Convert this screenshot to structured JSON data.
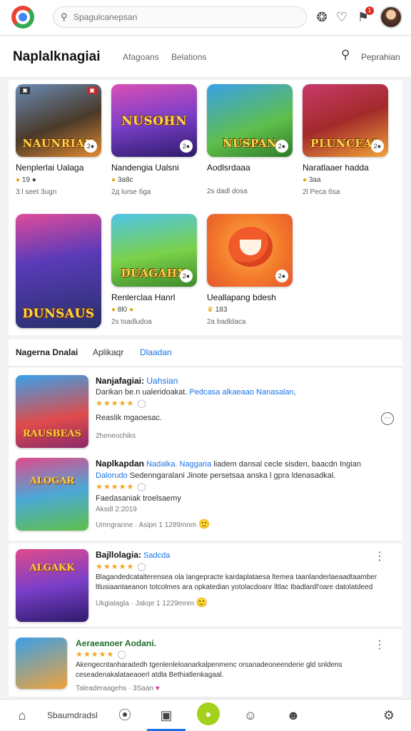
{
  "topbar": {
    "search_placeholder": "Spagulcanepsan",
    "notification_count": "1"
  },
  "header": {
    "title": "Naplalknagiai",
    "tabs": [
      "Afagoans",
      "Belations"
    ],
    "right_link": "Peprahian"
  },
  "grid": [
    {
      "name": "Nenplerlai Ualaga",
      "rating": "19 ●",
      "meta": "3:l seet 3ugn",
      "art": "NAUNRIAN"
    },
    {
      "name": "Nandengia Ualsni",
      "rating": "3a8с",
      "meta": "2д lurse бga",
      "art": "NUSOHN"
    },
    {
      "name": "Aodlsrdaaa",
      "rating": "",
      "meta": "2s dadl dosa",
      "art": "NUSPAN"
    },
    {
      "name": "Naratlaaer hadda",
      "rating": "3aa",
      "meta": "2l Peca бsa",
      "art": "PLUNCEAS"
    },
    {
      "name": "",
      "rating": "",
      "meta": "",
      "art": "DUNSAUS"
    },
    {
      "name": "Renlerclaa Hanrl",
      "rating": "8l0",
      "meta": "2s tsadludoa",
      "art": "DUAGAHN"
    },
    {
      "name": "Ueallapang bdesh",
      "rating": "183",
      "meta": "2a badldaca",
      "art": ""
    }
  ],
  "section": {
    "title": "Nagerna Dnalai",
    "tabs": [
      "Aplikaqr",
      "Dlaadan"
    ]
  },
  "list": [
    {
      "title": "Nanjafagiai:",
      "title_hl": "Uahsian",
      "desc": "Darikan be.n ualeridoakat.",
      "desc_hl": "Pedcasa alkaeaao Nanasalan,",
      "stars": "★★★★★",
      "line1": "Reaslik mgaoesac.",
      "line2": "2heneochiks",
      "art": "RAUSBEAS"
    },
    {
      "title": "Naplkapdan",
      "title_hl": "Nadalka. Naggaria",
      "desc_rest": " liadem dansal cecle sisden, baacdn Ingian",
      "desc2_hl": "Dalorudo",
      "desc2": " Sedenngaralani Jinote persetsaa anska l gpra ldenasadkal.",
      "stars": "★★★★★",
      "line1": "Faedasaniak troelsaemy",
      "line2": "Aksdl 2:2019",
      "footer": "Umngranne · Asipn 1 1289mnm",
      "art": "ALOGAR"
    },
    {
      "title": "Bajllolagia:",
      "title_hl": "Sadcda",
      "stars": "★★★★★",
      "desc": "Blagandedcatalterensea ola langepracte kardaplataesa ltemea taanlanderlaeaadtaamber ltlusiaantaeanon totcolmes ara opkatedian yotolacdoanr lltlac Ibadlardl'oare datolatdeed",
      "footer": "Ukgialagla · Jakqe 1 1229mnm",
      "art": "ALGAKK"
    },
    {
      "title": "Aeraeanoer Aodani.",
      "stars": "★★★★★",
      "desc": "Akengecntanharadedh tgenlenleloanarkalpenmenc orsanadeoneenderie gld snldens ceseadenakalataeaoerl atdla Bethiatlenkagaal.",
      "footer": "Taleaderaagehs · 3Saan",
      "art": ""
    }
  ],
  "bottomnav": {
    "label": "Sbaumdradsl"
  }
}
